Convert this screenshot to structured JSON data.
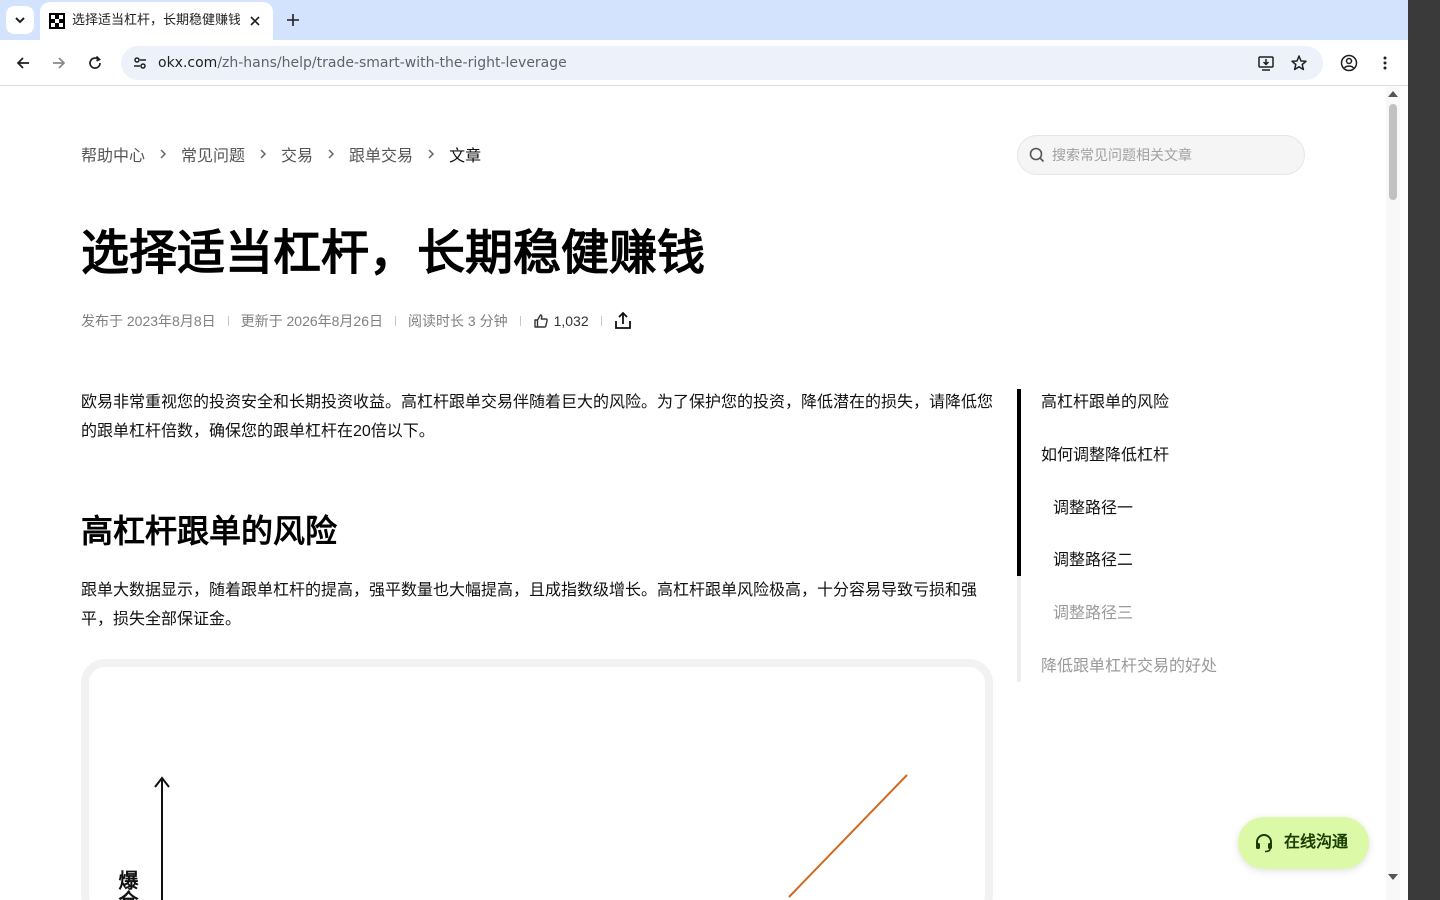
{
  "browser": {
    "tab": {
      "title": "选择适当杠杆，长期稳健赚钱"
    },
    "url": {
      "host": "okx.com",
      "path": "/zh-hans/help/trade-smart-with-the-right-leverage"
    }
  },
  "breadcrumb": {
    "items": [
      "帮助中心",
      "常见问题",
      "交易",
      "跟单交易",
      "文章"
    ]
  },
  "search": {
    "placeholder": "搜索常见问题相关文章"
  },
  "article": {
    "title": "选择适当杠杆，长期稳健赚钱",
    "meta": {
      "published": "发布于 2023年8月8日",
      "updated": "更新于 2026年8月26日",
      "read_time": "阅读时长 3 分钟",
      "likes": "1,032"
    },
    "intro": "欧易非常重视您的投资安全和长期投资收益。高杠杆跟单交易伴随着巨大的风险。为了保护您的投资，降低潜在的损失，请降低您的跟单杠杆倍数，确保您的跟单杠杆在20倍以下。",
    "section_heading": "高杠杆跟单的风险",
    "section_para": "跟单大数据显示，随着跟单杠杆的提高，强平数量也大幅提高，且成指数级增长。高杠杆跟单风险极高，十分容易导致亏损和强平，损失全部保证金。",
    "chart_axis_label": "爆仓"
  },
  "toc": {
    "items": [
      {
        "label": "高杠杆跟单的风险",
        "level": 1,
        "state": "read"
      },
      {
        "label": "如何调整降低杠杆",
        "level": 1,
        "state": "read"
      },
      {
        "label": "调整路径一",
        "level": 2,
        "state": "read"
      },
      {
        "label": "调整路径二",
        "level": 2,
        "state": "read"
      },
      {
        "label": "调整路径三",
        "level": 2,
        "state": "unread"
      },
      {
        "label": "降低跟单杠杆交易的好处",
        "level": 1,
        "state": "unread"
      }
    ]
  },
  "chat": {
    "label": "在线沟通"
  },
  "colors": {
    "accent": "#dcf9a8",
    "chart_line": "#d2691e"
  }
}
